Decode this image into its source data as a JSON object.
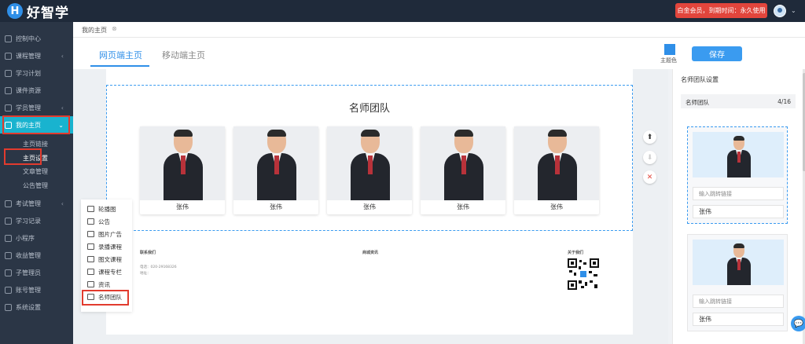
{
  "header": {
    "logo_mark": "H",
    "logo_text": "好智学",
    "member_badge": "白金会员，到期时间：永久使用"
  },
  "sidebar": {
    "items": [
      {
        "label": "控制中心",
        "icon": "home-icon",
        "chevron": ""
      },
      {
        "label": "课程管理",
        "icon": "book-icon",
        "chevron": "‹"
      },
      {
        "label": "学习计划",
        "icon": "plan-icon",
        "chevron": ""
      },
      {
        "label": "课件资源",
        "icon": "cloud-icon",
        "chevron": ""
      },
      {
        "label": "学员管理",
        "icon": "user-icon",
        "chevron": "‹"
      },
      {
        "label": "我的主页",
        "icon": "flag-icon",
        "chevron": "⌄"
      }
    ],
    "sub_items": [
      "主页链接",
      "主页设置",
      "文章管理",
      "公告管理"
    ],
    "items_bottom": [
      {
        "label": "考试管理",
        "icon": "exam-icon",
        "chevron": "‹"
      },
      {
        "label": "学习记录",
        "icon": "record-icon",
        "chevron": ""
      },
      {
        "label": "小程序",
        "icon": "miniapp-icon",
        "chevron": ""
      },
      {
        "label": "收益管理",
        "icon": "income-icon",
        "chevron": ""
      },
      {
        "label": "子管理员",
        "icon": "admin-icon",
        "chevron": ""
      },
      {
        "label": "账号管理",
        "icon": "dollar-icon",
        "chevron": ""
      },
      {
        "label": "系统设置",
        "icon": "settings-icon",
        "chevron": ""
      }
    ]
  },
  "breadcrumb": {
    "label": "我的主页",
    "close": "⊗"
  },
  "tabs": [
    {
      "label": "网页端主页"
    },
    {
      "label": "移动端主页"
    }
  ],
  "toolbar": {
    "theme_label": "主题色",
    "save_label": "保存",
    "theme_color": "#2f8fe8"
  },
  "section": {
    "title": "名师团队",
    "teachers": [
      "张伟",
      "张伟",
      "张伟",
      "张伟",
      "张伟"
    ]
  },
  "footer": {
    "col1_title": "联系我们",
    "col2_title": "商城资讯",
    "col3_title": "关于我们",
    "phone": "电话：020-29168326",
    "address": "地址："
  },
  "widgets": [
    "轮播图",
    "公告",
    "图片广告",
    "录播课程",
    "图文课程",
    "课程专栏",
    "资讯",
    "名师团队"
  ],
  "right_panel": {
    "title": "名师团队设置",
    "bar_label": "名师团队",
    "count": "4/16",
    "link_placeholder": "输入跳转链接",
    "cards": [
      {
        "name": "张伟"
      },
      {
        "name": "张伟"
      }
    ]
  }
}
